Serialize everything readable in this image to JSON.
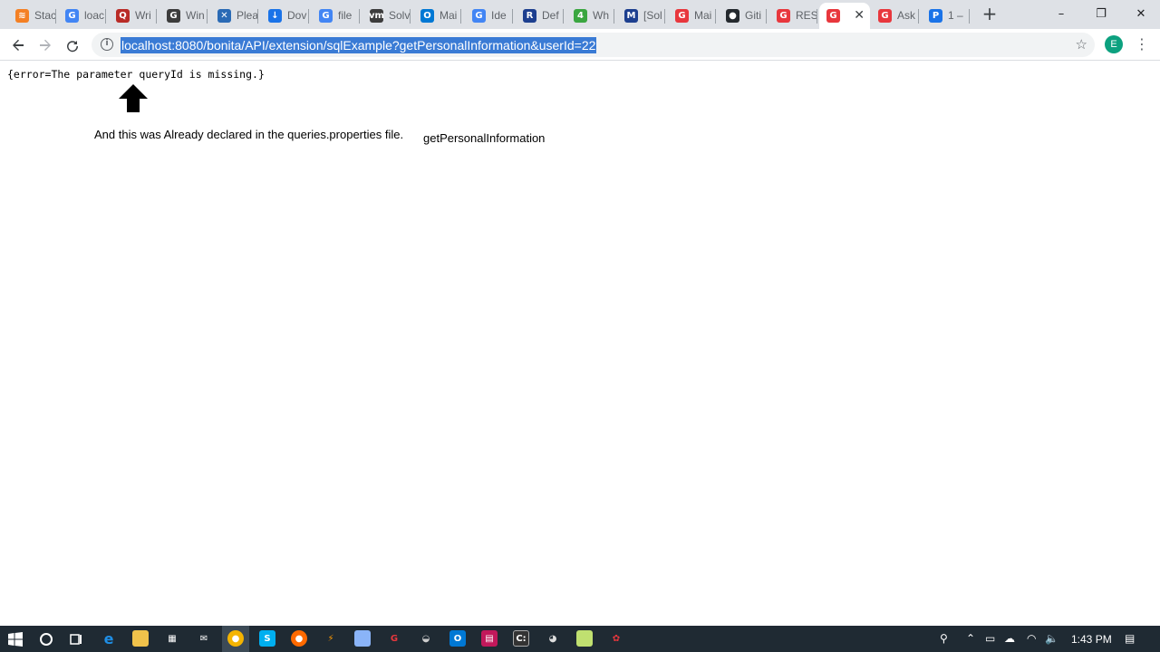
{
  "browser": {
    "tabs": [
      {
        "label": "Stac",
        "icon": "stackoverflow-icon",
        "color": "#f48024",
        "glyph": "≋"
      },
      {
        "label": "loac",
        "icon": "google-icon",
        "color": "#4285f4",
        "glyph": "G"
      },
      {
        "label": "Wri",
        "icon": "quora-icon",
        "color": "#b92b27",
        "glyph": "Q"
      },
      {
        "label": "Win",
        "icon": "grammarly-icon",
        "color": "#3c3c3c",
        "glyph": "G"
      },
      {
        "label": "Plea",
        "icon": "blue-circle-icon",
        "color": "#2a6ab5",
        "glyph": "✕"
      },
      {
        "label": "Dov",
        "icon": "download-icon",
        "color": "#1a73e8",
        "glyph": "↓"
      },
      {
        "label": "file",
        "icon": "google-icon",
        "color": "#4285f4",
        "glyph": "G"
      },
      {
        "label": "Solv",
        "icon": "vm-icon",
        "color": "#3c3c3c",
        "glyph": "vm"
      },
      {
        "label": "Mai",
        "icon": "outlook-icon",
        "color": "#0078d4",
        "glyph": "O"
      },
      {
        "label": "Ide",
        "icon": "google-icon",
        "color": "#4285f4",
        "glyph": "G"
      },
      {
        "label": "Def",
        "icon": "bookmark-icon",
        "color": "#1d3f8f",
        "glyph": "R"
      },
      {
        "label": "Wh",
        "icon": "green-circle-icon",
        "color": "#3aa640",
        "glyph": "4"
      },
      {
        "label": "[Sol",
        "icon": "m-icon",
        "color": "#1d3f8f",
        "glyph": "M"
      },
      {
        "label": "Mai",
        "icon": "bonita-icon",
        "color": "#e8373d",
        "glyph": "G"
      },
      {
        "label": "Giti",
        "icon": "github-icon",
        "color": "#24292e",
        "glyph": "●"
      },
      {
        "label": "RES",
        "icon": "bonita-icon",
        "color": "#e8373d",
        "glyph": "G"
      },
      {
        "label": "",
        "icon": "bonita-icon",
        "color": "#e8373d",
        "glyph": "G"
      },
      {
        "label": "Ask",
        "icon": "bonita-icon",
        "color": "#e8373d",
        "glyph": "G"
      },
      {
        "label": "1 –",
        "icon": "blue-square-icon",
        "color": "#1a73e8",
        "glyph": "P"
      }
    ],
    "url": "localhost:8080/bonita/API/extension/sqlExample?getPersonalInformation&userId=22",
    "avatar_letter": "E"
  },
  "page": {
    "error_text": "{error=The parameter queryId is missing.}",
    "note": "And this was Already declared in the queries.properties file.",
    "query_name": "getPersonalInformation"
  },
  "taskbar": {
    "clock": "1:43 PM"
  }
}
